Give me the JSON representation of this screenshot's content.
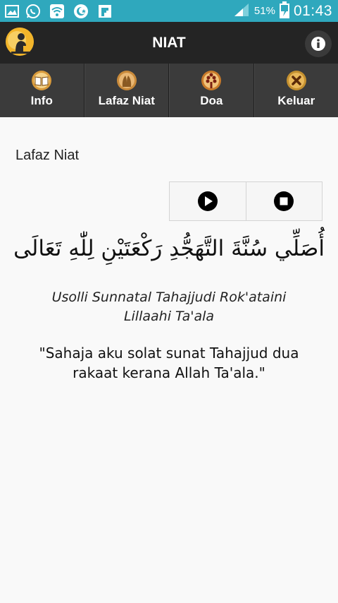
{
  "status_bar": {
    "battery_percent": "51%",
    "time": "01:43",
    "background": "#2fa8bd",
    "icons": [
      "gallery-icon",
      "whatsapp-icon",
      "wifi-download-icon",
      "moon-star-icon",
      "flipboard-icon",
      "signal-icon",
      "battery-charging-icon"
    ]
  },
  "header": {
    "title": "NIAT",
    "logo_icon": "praying-man-logo-icon",
    "info_icon": "info-icon"
  },
  "tabs": [
    {
      "label": "Info",
      "icon": "book-icon"
    },
    {
      "label": "Lafaz Niat",
      "icon": "praying-hands-icon"
    },
    {
      "label": "Doa",
      "icon": "prayer-beads-icon"
    },
    {
      "label": "Keluar",
      "icon": "exit-x-icon"
    }
  ],
  "main": {
    "section_title": "Lafaz Niat",
    "play_icon": "play-icon",
    "stop_icon": "stop-icon",
    "arabic_text": "أُصَلِّي سُنَّةَ التَّهَجُّدِ رَكْعَتَيْنِ لِلّٰهِ تَعَالَى",
    "transliteration": "Usolli Sunnatal Tahajjudi Rok'ataini Lillaahi Ta'ala",
    "meaning": "\"Sahaja aku solat sunat Tahajjud dua rakaat kerana Allah Ta'ala.\""
  },
  "colors": {
    "status_bar": "#2fa8bd",
    "action_bar": "#242424",
    "tab_bar": "#3b3b3b",
    "logo_bg": "#f2b52b"
  }
}
